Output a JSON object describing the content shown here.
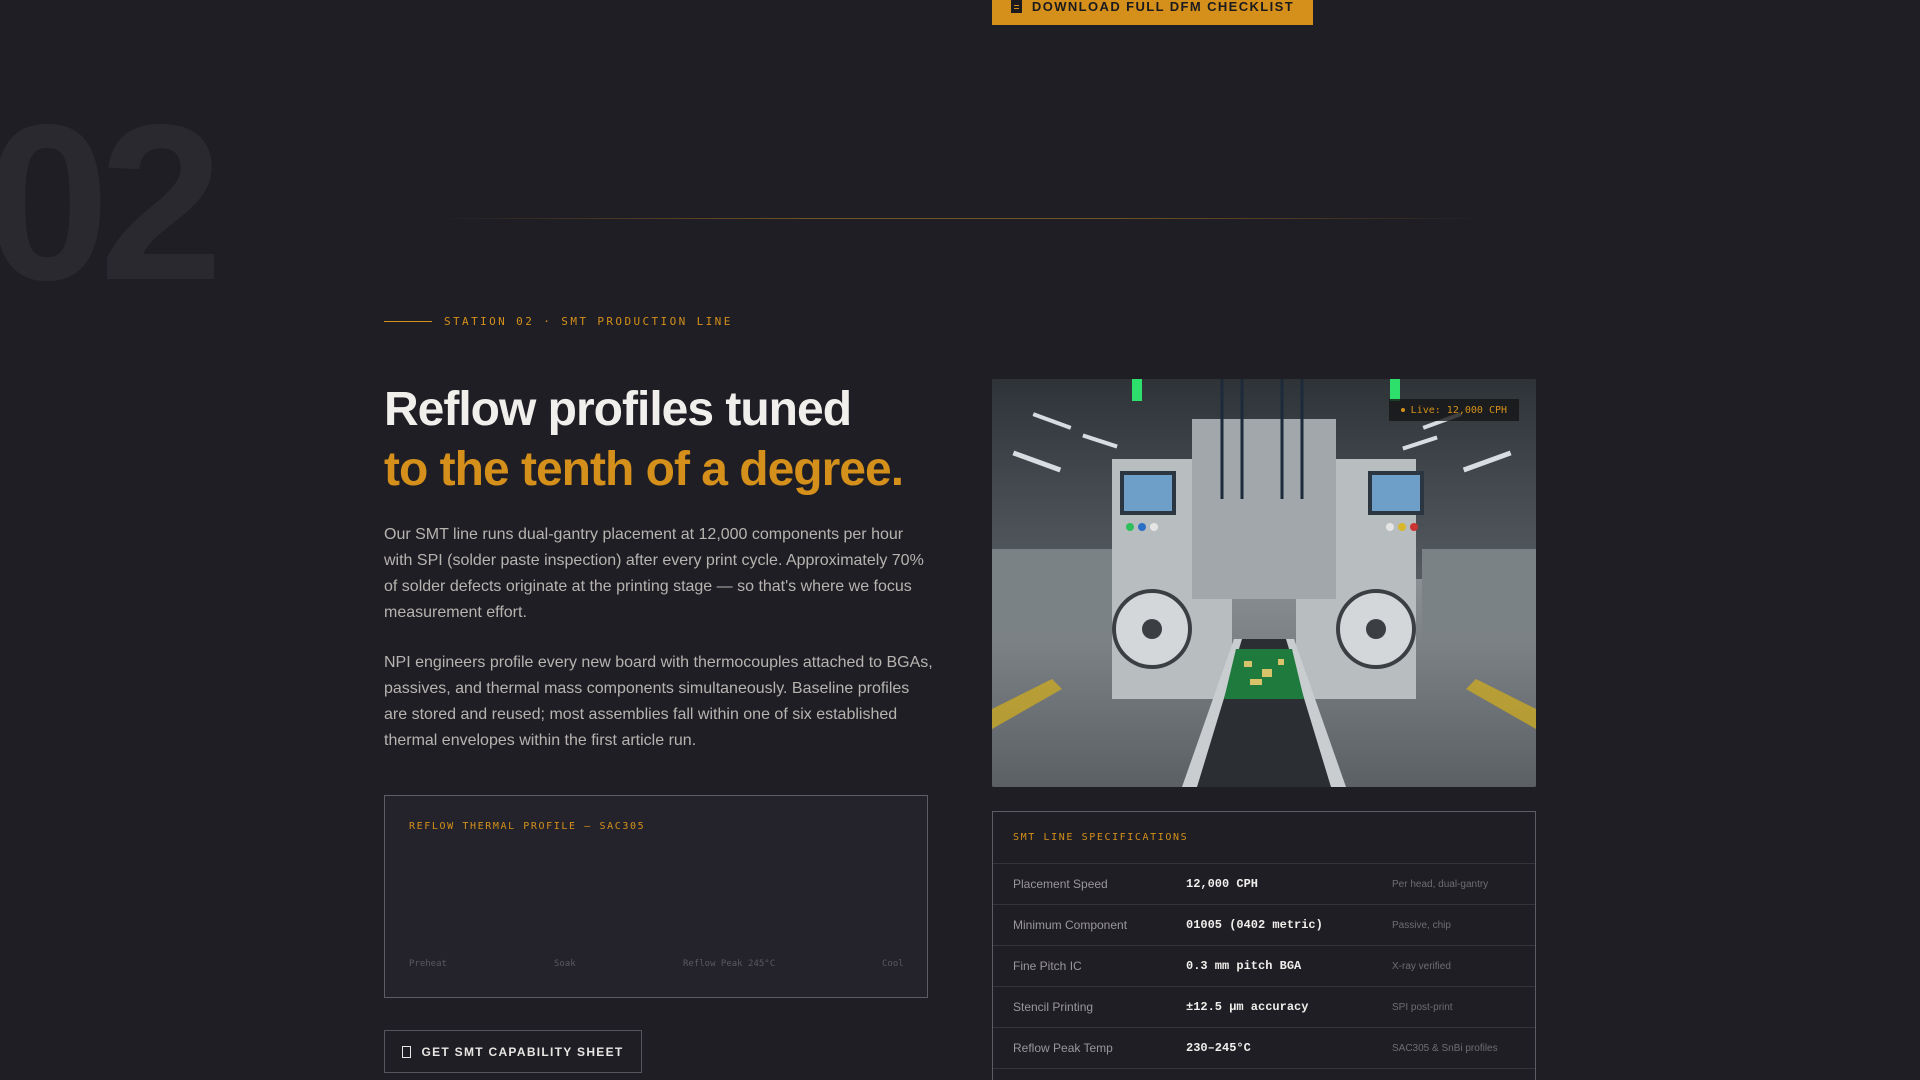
{
  "top_cta": {
    "label": "DOWNLOAD FULL DFM CHECKLIST"
  },
  "station": {
    "number": "02",
    "eyebrow": "STATION 02 · SMT PRODUCTION LINE"
  },
  "headline": {
    "line1": "Reflow profiles tuned",
    "line2": "to the tenth of a degree."
  },
  "paragraphs": [
    "Our SMT line runs dual-gantry placement at 12,000 components per hour with SPI (solder paste inspection) after every print cycle. Approximately 70% of solder defects originate at the printing stage — so that's where we focus measurement effort.",
    "NPI engineers profile every new board with thermocouples attached to BGAs, passives, and thermal mass components simultaneously. Baseline profiles are stored and reused; most assemblies fall within one of six established thermal envelopes within the first article run."
  ],
  "reflow_chart": {
    "title": "REFLOW THERMAL PROFILE — SAC305",
    "stages": [
      "Preheat",
      "Soak",
      "Reflow Peak 245°C",
      "Cool"
    ]
  },
  "bottom_cta": {
    "label": "GET SMT CAPABILITY SHEET"
  },
  "photo": {
    "live_badge": "Live: 12,000 CPH"
  },
  "specs": {
    "title": "SMT LINE SPECIFICATIONS",
    "rows": [
      {
        "label": "Placement Speed",
        "value": "12,000 CPH",
        "note": "Per head, dual-gantry"
      },
      {
        "label": "Minimum Component",
        "value": "01005 (0402 metric)",
        "note": "Passive, chip"
      },
      {
        "label": "Fine Pitch IC",
        "value": "0.3 mm pitch BGA",
        "note": "X-ray verified"
      },
      {
        "label": "Stencil Printing",
        "value": "±12.5 µm accuracy",
        "note": "SPI post-print"
      },
      {
        "label": "Reflow Peak Temp",
        "value": "230–245°C",
        "note": "SAC305 & SnBi profiles"
      }
    ]
  },
  "colors": {
    "background": "#1f1e24",
    "accent": "#d4901a",
    "heading": "#f1efec",
    "body": "#b7b4b0"
  }
}
